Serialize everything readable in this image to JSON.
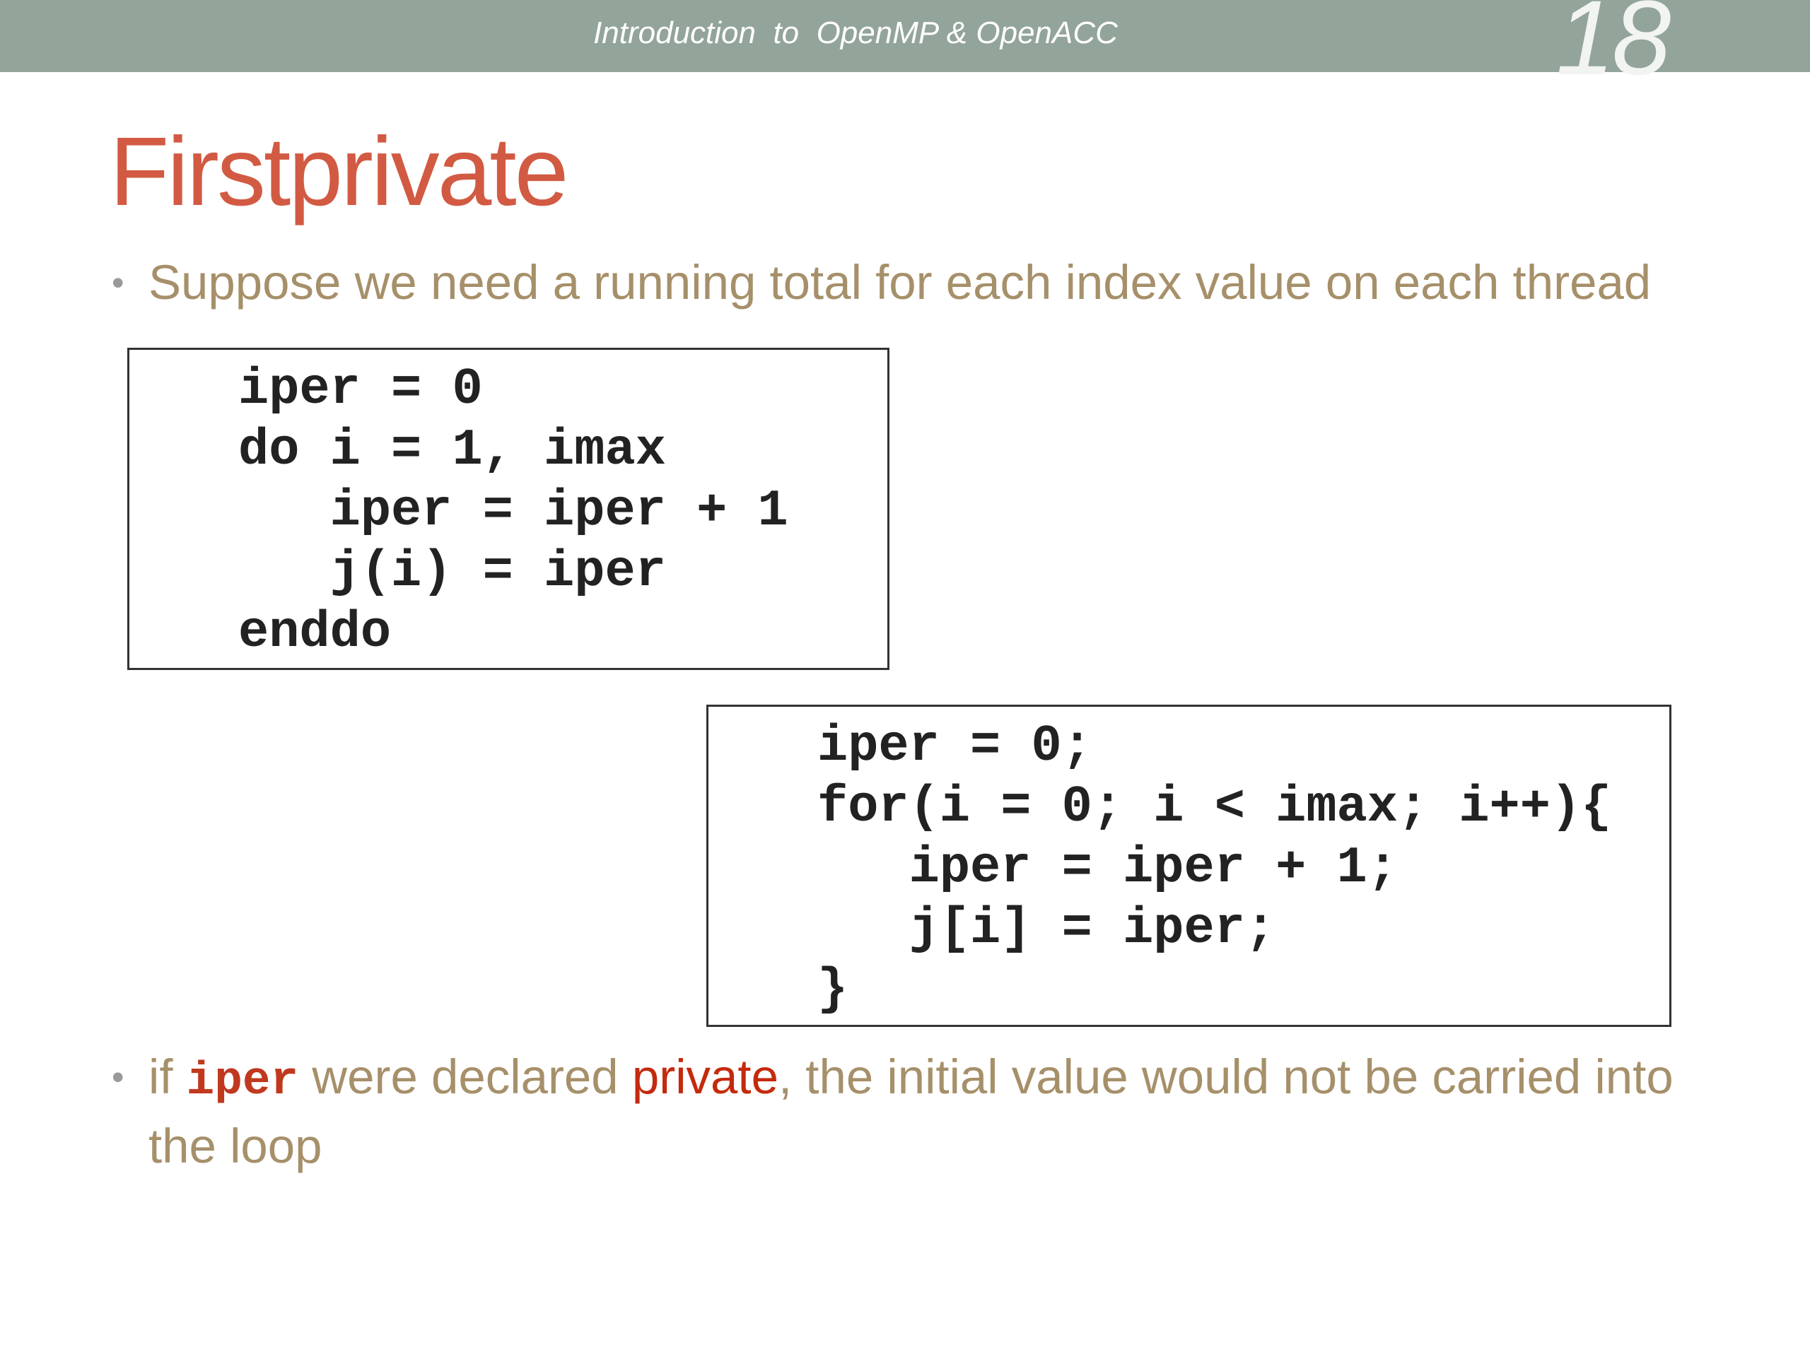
{
  "header": {
    "title": "Introduction  to  OpenMP & OpenACC",
    "slide_number": "18"
  },
  "slide": {
    "title": "Firstprivate",
    "bullet_symbol": "•",
    "bullet1": "Suppose we need a running total for each index value on each thread",
    "bullet2": {
      "prefix": "if ",
      "code_word": "iper",
      "middle": " were declared ",
      "highlight": "private",
      "suffix": ", the initial value would not be carried into the loop"
    }
  },
  "code_fortran": {
    "lines": [
      "iper = 0",
      "do i = 1, imax",
      "   iper = iper + 1",
      "   j(i) = iper",
      "enddo"
    ]
  },
  "code_c": {
    "lines": [
      "iper = 0;",
      "for(i = 0; i < imax; i++){",
      "   iper = iper + 1;",
      "   j[i] = iper;",
      "}"
    ]
  }
}
